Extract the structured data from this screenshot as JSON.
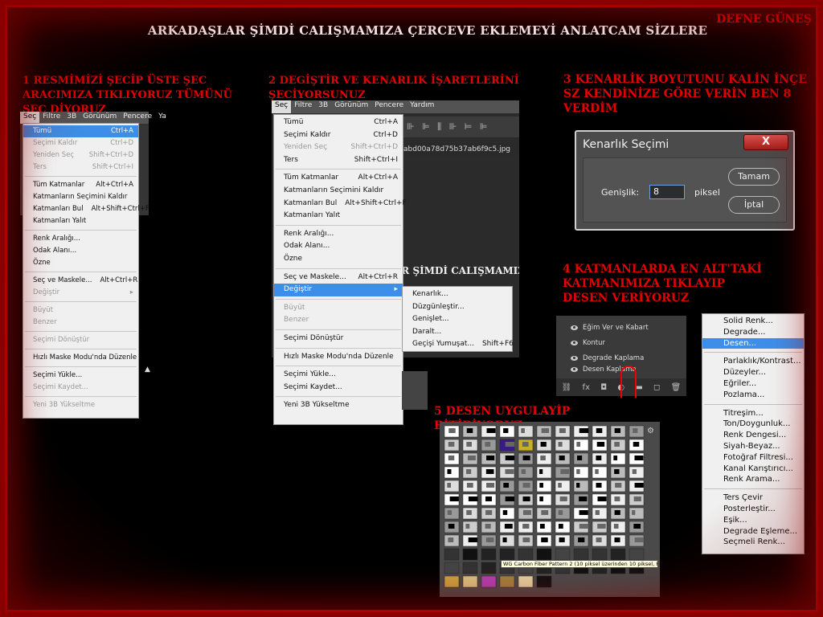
{
  "header": {
    "title": "ARKADAŞLAR ŞİMDİ CALIŞMAMIZA ÇERCEVE EKLEMEYİ ANLATCAM SİZLERE",
    "author": "DEFNE GÜNEŞ"
  },
  "steps": {
    "s1": "1  RESMİMİZİ ŞECİP ÜSTE ŞEC ARACIMIZA TIKLIYORUZ TÜMÜNÜ ŞEC DİYORUZ",
    "s2": "2 DEGİŞTİR VE KENARLIK İŞARETLERİNİ ŞECİYORSUNUZ",
    "s3": "3 KENARLİK BOYUTUNU KALİN İNÇE SZ KENDİNİZE GÖRE VERİN BEN 8 VERDİM",
    "s4": "4 KATMANLARDA EN ALT'TAKİ  KATMANIMIZA TIKLAYIP DESEN VERİYORUZ",
    "s5": "5 DESEN UYGULAYİP BİTİRİYORUZ"
  },
  "menubar1": [
    "Seç",
    "Filtre",
    "3B",
    "Görünüm",
    "Pencere",
    "Ya"
  ],
  "menubar2": [
    "Seç",
    "Filtre",
    "3B",
    "Görünüm",
    "Pencere",
    "Yardım"
  ],
  "menu1": [
    {
      "label": "Tümü",
      "sc": "Ctrl+A",
      "state": "sel"
    },
    {
      "label": "Seçimi Kaldır",
      "sc": "Ctrl+D",
      "state": "dis"
    },
    {
      "label": "Yeniden Seç",
      "sc": "Shift+Ctrl+D",
      "state": "dis"
    },
    {
      "label": "Ters",
      "sc": "Shift+Ctrl+I",
      "state": "dis"
    },
    {
      "sep": true
    },
    {
      "label": "Tüm Katmanlar",
      "sc": "Alt+Ctrl+A"
    },
    {
      "label": "Katmanların Seçimini Kaldır",
      "sc": ""
    },
    {
      "label": "Katmanları Bul",
      "sc": "Alt+Shift+Ctrl+F"
    },
    {
      "label": "Katmanları Yalıt",
      "sc": ""
    },
    {
      "sep": true
    },
    {
      "label": "Renk Aralığı...",
      "sc": ""
    },
    {
      "label": "Odak Alanı...",
      "sc": ""
    },
    {
      "label": "Özne",
      "sc": ""
    },
    {
      "sep": true
    },
    {
      "label": "Seç ve Maskele...",
      "sc": "Alt+Ctrl+R"
    },
    {
      "label": "Değiştir",
      "sc": "▸",
      "state": "dis"
    },
    {
      "sep": true
    },
    {
      "label": "Büyüt",
      "sc": "",
      "state": "dis"
    },
    {
      "label": "Benzer",
      "sc": "",
      "state": "dis"
    },
    {
      "sep": true
    },
    {
      "label": "Seçimi Dönüştür",
      "sc": "",
      "state": "dis"
    },
    {
      "sep": true
    },
    {
      "label": "Hızlı Maske Modu'nda Düzenle",
      "sc": ""
    },
    {
      "sep": true
    },
    {
      "label": "Seçimi Yükle...",
      "sc": ""
    },
    {
      "label": "Seçimi Kaydet...",
      "sc": "",
      "state": "dis"
    },
    {
      "sep": true
    },
    {
      "label": "Yeni 3B Yükseltme",
      "sc": "",
      "state": "dis"
    }
  ],
  "menu2": [
    {
      "label": "Tümü",
      "sc": "Ctrl+A"
    },
    {
      "label": "Seçimi Kaldır",
      "sc": "Ctrl+D"
    },
    {
      "label": "Yeniden Seç",
      "sc": "Shift+Ctrl+D",
      "state": "dis"
    },
    {
      "label": "Ters",
      "sc": "Shift+Ctrl+I"
    },
    {
      "sep": true
    },
    {
      "label": "Tüm Katmanlar",
      "sc": "Alt+Ctrl+A"
    },
    {
      "label": "Katmanların Seçimini Kaldır",
      "sc": ""
    },
    {
      "label": "Katmanları Bul",
      "sc": "Alt+Shift+Ctrl+F"
    },
    {
      "label": "Katmanları Yalıt",
      "sc": ""
    },
    {
      "sep": true
    },
    {
      "label": "Renk Aralığı...",
      "sc": ""
    },
    {
      "label": "Odak Alanı...",
      "sc": ""
    },
    {
      "label": "Özne",
      "sc": ""
    },
    {
      "sep": true
    },
    {
      "label": "Seç ve Maskele...",
      "sc": "Alt+Ctrl+R"
    },
    {
      "label": "Değiştir",
      "sc": "▸",
      "state": "sel"
    },
    {
      "sep": true
    },
    {
      "label": "Büyüt",
      "sc": "",
      "state": "dis"
    },
    {
      "label": "Benzer",
      "sc": "",
      "state": "dis"
    },
    {
      "sep": true
    },
    {
      "label": "Seçimi Dönüştür",
      "sc": ""
    },
    {
      "sep": true
    },
    {
      "label": "Hızlı Maske Modu'nda Düzenle",
      "sc": ""
    },
    {
      "sep": true
    },
    {
      "label": "Seçimi Yükle...",
      "sc": ""
    },
    {
      "label": "Seçimi Kaydet...",
      "sc": ""
    },
    {
      "sep": true
    },
    {
      "label": "Yeni 3B Yükseltme",
      "sc": ""
    }
  ],
  "submenu": [
    {
      "label": "Kenarlık...",
      "sc": ""
    },
    {
      "label": "Düzgünleştir...",
      "sc": ""
    },
    {
      "label": "Genişlet...",
      "sc": ""
    },
    {
      "label": "Daralt...",
      "sc": ""
    },
    {
      "label": "Geçişi Yumuşat...",
      "sc": "Shift+F6"
    }
  ],
  "tab_text": "abd00a78d75b37ab6f9c5.jpg",
  "bg_text": "AR ŞİMDİ CALIŞMAMIZA Ç",
  "dialog": {
    "title": "Kenarlık Seçimi",
    "close": "X",
    "label": "Genişlik:",
    "value": "8",
    "unit": "piksel",
    "ok": "Tamam",
    "cancel": "İptal"
  },
  "layers": [
    "Eğim Ver ve Kabart",
    "Kontur",
    "Degrade Kaplama",
    "Desen Kaplama"
  ],
  "layer_bar": [
    "⛓",
    "fx",
    "◘",
    "◐",
    "▬",
    "◻",
    "🗑"
  ],
  "adj_menu": [
    {
      "label": "Solid Renk..."
    },
    {
      "label": "Degrade..."
    },
    {
      "label": "Desen...",
      "state": "sel"
    },
    {
      "sep": true
    },
    {
      "label": "Parlaklık/Kontrast..."
    },
    {
      "label": "Düzeyler..."
    },
    {
      "label": "Eğriler..."
    },
    {
      "label": "Pozlama..."
    },
    {
      "sep": true
    },
    {
      "label": "Titreşim..."
    },
    {
      "label": "Ton/Doygunluk..."
    },
    {
      "label": "Renk Dengesi..."
    },
    {
      "label": "Siyah-Beyaz..."
    },
    {
      "label": "Fotoğraf Filtresi..."
    },
    {
      "label": "Kanal Karıştırıcı..."
    },
    {
      "label": "Renk Arama..."
    },
    {
      "sep": true
    },
    {
      "label": "Ters Çevir"
    },
    {
      "label": "Posterleştir..."
    },
    {
      "label": "Eşik..."
    },
    {
      "label": "Degrade Eşleme..."
    },
    {
      "label": "Seçmeli Renk..."
    }
  ],
  "tooltip": "WG Carbon Fiber Pattern 2 (10 piksel üzerinden 10 piksel, RGB)"
}
